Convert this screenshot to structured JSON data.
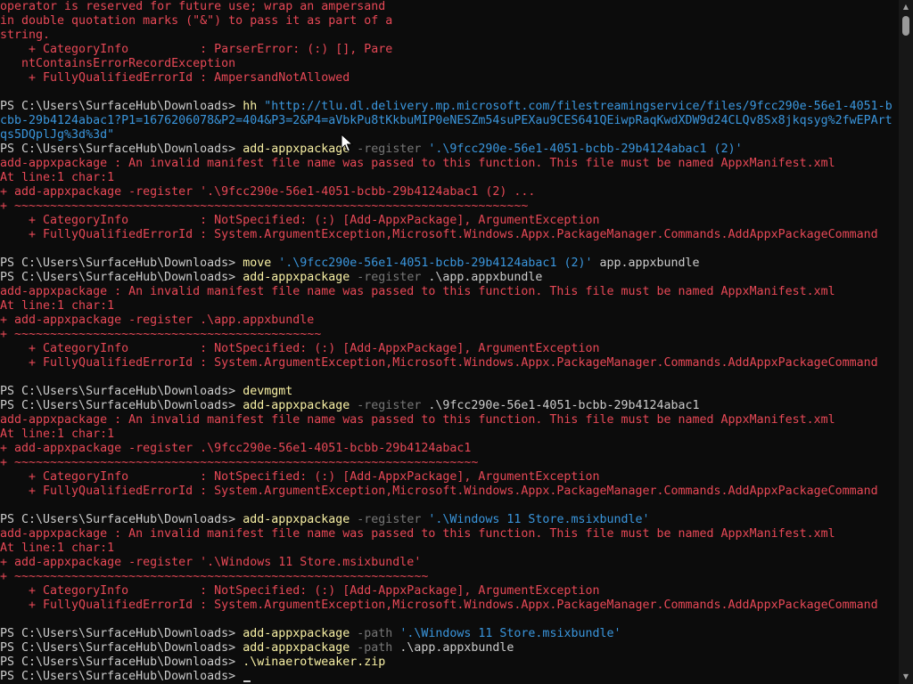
{
  "colors": {
    "background": "#0c0c0c",
    "normal": "#cccccc",
    "command": "#f9f1a5",
    "parameter": "#767676",
    "string": "#3a96dd",
    "error": "#e74856"
  },
  "terminal": {
    "lines": [
      [
        {
          "t": "operator is reserved for future use; wrap an ampersand",
          "c": "error"
        }
      ],
      [
        {
          "t": "in double quotation marks (\"&\") to pass it as part of a",
          "c": "error"
        }
      ],
      [
        {
          "t": "string.",
          "c": "error"
        }
      ],
      [
        {
          "t": "    + CategoryInfo          : ParserError: (:) [], Pare",
          "c": "error"
        }
      ],
      [
        {
          "t": "   ntContainsErrorRecordException",
          "c": "error"
        }
      ],
      [
        {
          "t": "    + FullyQualifiedErrorId : AmpersandNotAllowed",
          "c": "error"
        }
      ],
      [],
      [
        {
          "t": "PS C:\\Users\\SurfaceHub\\Downloads> ",
          "c": "normal"
        },
        {
          "t": "hh",
          "c": "command"
        },
        {
          "t": " ",
          "c": "normal"
        },
        {
          "t": "\"http://tlu.dl.delivery.mp.microsoft.com/filestreamingservice/files/9fcc290e-56e1-4051-b",
          "c": "string"
        }
      ],
      [
        {
          "t": "cbb-29b4124abac1?P1=1676206078&P2=404&P3=2&P4=aVbkPu8tKkbuMIP0eNESZm54suPEXau9CES641QEiwpRaqKwdXDW9d24CLQv8Sx8jkqsyg%2fwEPArt",
          "c": "string"
        }
      ],
      [
        {
          "t": "qs5DQplJg%3d%3d\"",
          "c": "string"
        }
      ],
      [
        {
          "t": "PS C:\\Users\\SurfaceHub\\Downloads> ",
          "c": "normal"
        },
        {
          "t": "add-appxpackage",
          "c": "command"
        },
        {
          "t": " -register ",
          "c": "parameter"
        },
        {
          "t": "'.\\9fcc290e-56e1-4051-bcbb-29b4124abac1 (2)'",
          "c": "string"
        }
      ],
      [
        {
          "t": "add-appxpackage : An invalid manifest file name was passed to this function. This file must be named AppxManifest.xml",
          "c": "error"
        }
      ],
      [
        {
          "t": "At line:1 char:1",
          "c": "error"
        }
      ],
      [
        {
          "t": "+ add-appxpackage -register '.\\9fcc290e-56e1-4051-bcbb-29b4124abac1 (2) ...",
          "c": "error"
        }
      ],
      [
        {
          "t": "+ ~~~~~~~~~~~~~~~~~~~~~~~~~~~~~~~~~~~~~~~~~~~~~~~~~~~~~~~~~~~~~~~~~~~~~~~~",
          "c": "error"
        }
      ],
      [
        {
          "t": "    + CategoryInfo          : NotSpecified: (:) [Add-AppxPackage], ArgumentException",
          "c": "error"
        }
      ],
      [
        {
          "t": "    + FullyQualifiedErrorId : System.ArgumentException,Microsoft.Windows.Appx.PackageManager.Commands.AddAppxPackageCommand",
          "c": "error"
        }
      ],
      [],
      [
        {
          "t": "PS C:\\Users\\SurfaceHub\\Downloads> ",
          "c": "normal"
        },
        {
          "t": "move",
          "c": "command"
        },
        {
          "t": " ",
          "c": "normal"
        },
        {
          "t": "'.\\9fcc290e-56e1-4051-bcbb-29b4124abac1 (2)'",
          "c": "string"
        },
        {
          "t": " app.appxbundle",
          "c": "normal"
        }
      ],
      [
        {
          "t": "PS C:\\Users\\SurfaceHub\\Downloads> ",
          "c": "normal"
        },
        {
          "t": "add-appxpackage",
          "c": "command"
        },
        {
          "t": " -register ",
          "c": "parameter"
        },
        {
          "t": ".\\app.appxbundle",
          "c": "normal"
        }
      ],
      [
        {
          "t": "add-appxpackage : An invalid manifest file name was passed to this function. This file must be named AppxManifest.xml",
          "c": "error"
        }
      ],
      [
        {
          "t": "At line:1 char:1",
          "c": "error"
        }
      ],
      [
        {
          "t": "+ add-appxpackage -register .\\app.appxbundle",
          "c": "error"
        }
      ],
      [
        {
          "t": "+ ~~~~~~~~~~~~~~~~~~~~~~~~~~~~~~~~~~~~~~~~~~~",
          "c": "error"
        }
      ],
      [
        {
          "t": "    + CategoryInfo          : NotSpecified: (:) [Add-AppxPackage], ArgumentException",
          "c": "error"
        }
      ],
      [
        {
          "t": "    + FullyQualifiedErrorId : System.ArgumentException,Microsoft.Windows.Appx.PackageManager.Commands.AddAppxPackageCommand",
          "c": "error"
        }
      ],
      [],
      [
        {
          "t": "PS C:\\Users\\SurfaceHub\\Downloads> ",
          "c": "normal"
        },
        {
          "t": "devmgmt",
          "c": "command"
        }
      ],
      [
        {
          "t": "PS C:\\Users\\SurfaceHub\\Downloads> ",
          "c": "normal"
        },
        {
          "t": "add-appxpackage",
          "c": "command"
        },
        {
          "t": " -register ",
          "c": "parameter"
        },
        {
          "t": ".\\9fcc290e-56e1-4051-bcbb-29b4124abac1",
          "c": "normal"
        }
      ],
      [
        {
          "t": "add-appxpackage : An invalid manifest file name was passed to this function. This file must be named AppxManifest.xml",
          "c": "error"
        }
      ],
      [
        {
          "t": "At line:1 char:1",
          "c": "error"
        }
      ],
      [
        {
          "t": "+ add-appxpackage -register .\\9fcc290e-56e1-4051-bcbb-29b4124abac1",
          "c": "error"
        }
      ],
      [
        {
          "t": "+ ~~~~~~~~~~~~~~~~~~~~~~~~~~~~~~~~~~~~~~~~~~~~~~~~~~~~~~~~~~~~~~~~~",
          "c": "error"
        }
      ],
      [
        {
          "t": "    + CategoryInfo          : NotSpecified: (:) [Add-AppxPackage], ArgumentException",
          "c": "error"
        }
      ],
      [
        {
          "t": "    + FullyQualifiedErrorId : System.ArgumentException,Microsoft.Windows.Appx.PackageManager.Commands.AddAppxPackageCommand",
          "c": "error"
        }
      ],
      [],
      [
        {
          "t": "PS C:\\Users\\SurfaceHub\\Downloads> ",
          "c": "normal"
        },
        {
          "t": "add-appxpackage",
          "c": "command"
        },
        {
          "t": " -register ",
          "c": "parameter"
        },
        {
          "t": "'.\\Windows 11 Store.msixbundle'",
          "c": "string"
        }
      ],
      [
        {
          "t": "add-appxpackage : An invalid manifest file name was passed to this function. This file must be named AppxManifest.xml",
          "c": "error"
        }
      ],
      [
        {
          "t": "At line:1 char:1",
          "c": "error"
        }
      ],
      [
        {
          "t": "+ add-appxpackage -register '.\\Windows 11 Store.msixbundle'",
          "c": "error"
        }
      ],
      [
        {
          "t": "+ ~~~~~~~~~~~~~~~~~~~~~~~~~~~~~~~~~~~~~~~~~~~~~~~~~~~~~~~~~~",
          "c": "error"
        }
      ],
      [
        {
          "t": "    + CategoryInfo          : NotSpecified: (:) [Add-AppxPackage], ArgumentException",
          "c": "error"
        }
      ],
      [
        {
          "t": "    + FullyQualifiedErrorId : System.ArgumentException,Microsoft.Windows.Appx.PackageManager.Commands.AddAppxPackageCommand",
          "c": "error"
        }
      ],
      [],
      [
        {
          "t": "PS C:\\Users\\SurfaceHub\\Downloads> ",
          "c": "normal"
        },
        {
          "t": "add-appxpackage",
          "c": "command"
        },
        {
          "t": " -path ",
          "c": "parameter"
        },
        {
          "t": "'.\\Windows 11 Store.msixbundle'",
          "c": "string"
        }
      ],
      [
        {
          "t": "PS C:\\Users\\SurfaceHub\\Downloads> ",
          "c": "normal"
        },
        {
          "t": "add-appxpackage",
          "c": "command"
        },
        {
          "t": " -path ",
          "c": "parameter"
        },
        {
          "t": ".\\app.appxbundle",
          "c": "normal"
        }
      ],
      [
        {
          "t": "PS C:\\Users\\SurfaceHub\\Downloads> ",
          "c": "normal"
        },
        {
          "t": ".\\winaerotweaker.zip",
          "c": "command"
        }
      ],
      [
        {
          "t": "PS C:\\Users\\SurfaceHub\\Downloads> ",
          "c": "normal"
        }
      ]
    ]
  },
  "scrollbar": {
    "up_icon": "▲",
    "down_icon": "▼"
  }
}
